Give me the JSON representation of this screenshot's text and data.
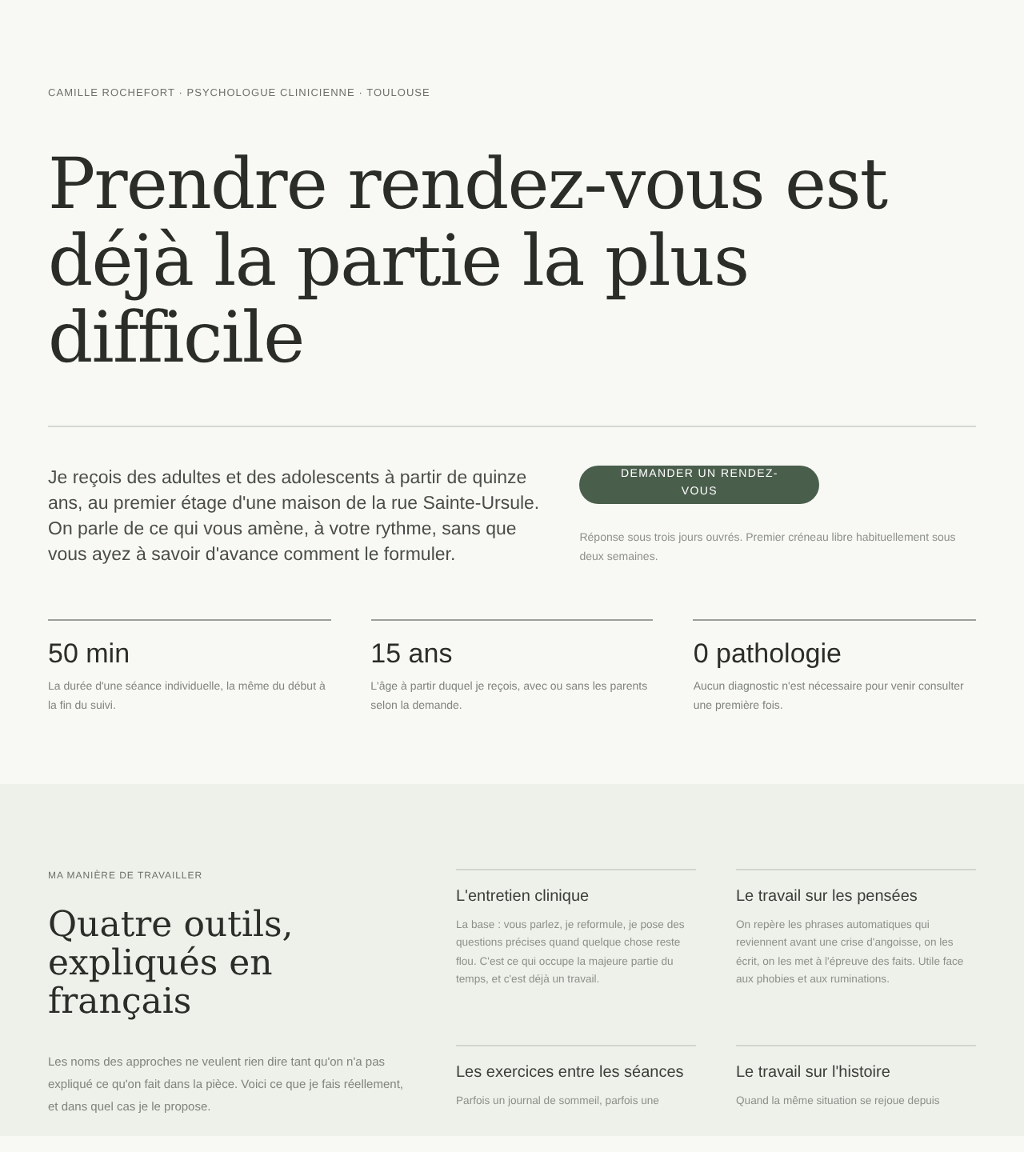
{
  "eyebrow": "CAMILLE ROCHEFORT · PSYCHOLOGUE CLINICIENNE · TOULOUSE",
  "title": "Prendre rendez-vous est déjà la partie la plus difficile",
  "intro": "Je reçois des adultes et des adolescents à partir de quinze ans, au premier étage d'une maison de la rue Sainte-Ursule. On parle de ce qui vous amène, à votre rythme, sans que vous ayez à savoir d'avance comment le formuler.",
  "cta": {
    "label": "DEMANDER UN RENDEZ-VOUS",
    "note": "Réponse sous trois jours ouvrés. Premier créneau libre habituellement sous deux semaines."
  },
  "stats": [
    {
      "value": "50 min",
      "text": "La durée d'une séance individuelle, la même du début à la fin du suivi."
    },
    {
      "value": "15 ans",
      "text": "L'âge à partir duquel je reçois, avec ou sans les parents selon la demande."
    },
    {
      "value": "0 pathologie",
      "text": "Aucun diagnostic n'est nécessaire pour venir consulter une première fois."
    }
  ],
  "method": {
    "eyebrow": "MA MANIÈRE DE TRAVAILLER",
    "title": "Quatre outils, expliqués en français",
    "text": "Les noms des approches ne veulent rien dire tant qu'on n'a pas expliqué ce qu'on fait dans la pièce. Voici ce que je fais réellement, et dans quel cas je le propose.",
    "tools": [
      {
        "title": "L'entretien clinique",
        "text": "La base : vous parlez, je reformule, je pose des questions précises quand quelque chose reste flou. C'est ce qui occupe la majeure partie du temps, et c'est déjà un travail."
      },
      {
        "title": "Le travail sur les pensées",
        "text": "On repère les phrases automatiques qui reviennent avant une crise d'angoisse, on les écrit, on les met à l'épreuve des faits. Utile face aux phobies et aux ruminations."
      },
      {
        "title": "Les exercices entre les séances",
        "text": "Parfois un journal de sommeil, parfois une"
      },
      {
        "title": "Le travail sur l'histoire",
        "text": "Quand la même situation se rejoue depuis"
      }
    ]
  }
}
